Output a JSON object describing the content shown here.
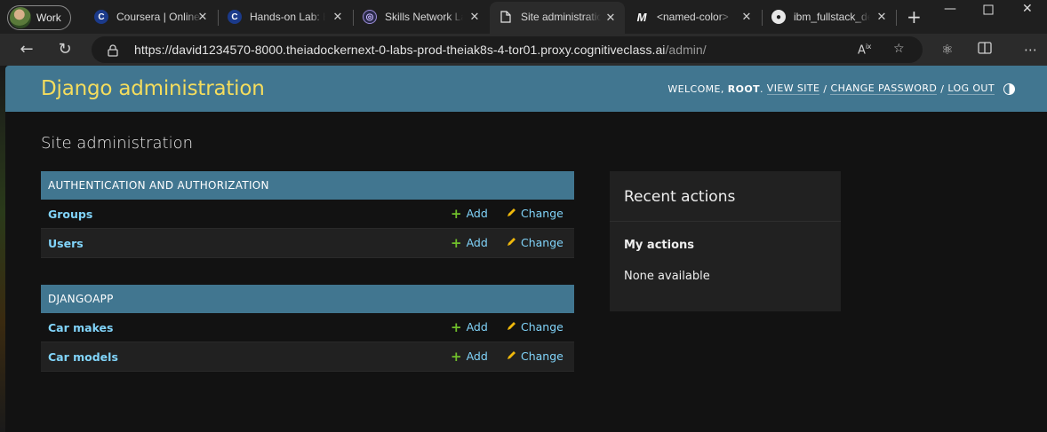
{
  "browser": {
    "profile_label": "Work",
    "tabs": [
      {
        "label": "Coursera | Online Courses",
        "icon": "coursera-icon"
      },
      {
        "label": "Hands-on Lab: Build",
        "icon": "coursera-icon"
      },
      {
        "label": "Skills Network Labs",
        "icon": "skills-network-icon"
      },
      {
        "label": "Site administration",
        "icon": "document-icon",
        "active": true
      },
      {
        "label": "<named-color>",
        "icon": "mdn-icon"
      },
      {
        "label": "ibm_fullstack_developer",
        "icon": "github-icon"
      }
    ],
    "url_host": "https://david1234570-8000.theiadockernext-0-labs-prod-theiak8s-4-tor01.proxy.cognitiveclass.ai",
    "url_path": "/admin/"
  },
  "site": {
    "branding": "Django administration",
    "welcome": "WELCOME,",
    "username": "ROOT",
    "view_site": "VIEW SITE",
    "change_password": "CHANGE PASSWORD",
    "log_out": "LOG OUT",
    "colors": {
      "header": "#417690",
      "branding": "#f5dd5d",
      "link": "#81d4fa",
      "add_icon": "#70bf2b",
      "change_icon": "#efb80b"
    }
  },
  "content": {
    "title": "Site administration",
    "apps": [
      {
        "name": "AUTHENTICATION AND AUTHORIZATION",
        "models": [
          {
            "name": "Groups",
            "add": "Add",
            "change": "Change"
          },
          {
            "name": "Users",
            "add": "Add",
            "change": "Change"
          }
        ]
      },
      {
        "name": "DJANGOAPP",
        "models": [
          {
            "name": "Car makes",
            "add": "Add",
            "change": "Change"
          },
          {
            "name": "Car models",
            "add": "Add",
            "change": "Change"
          }
        ]
      }
    ]
  },
  "recent_actions": {
    "title": "Recent actions",
    "my_actions": "My actions",
    "none": "None available"
  }
}
